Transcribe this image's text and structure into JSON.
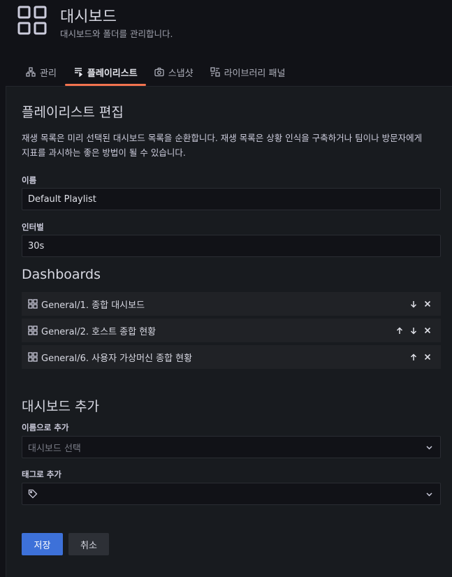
{
  "header": {
    "title": "대시보드",
    "subtitle": "대시보드와 폴더를 관리합니다."
  },
  "tabs": [
    {
      "label": "관리",
      "icon": "sitemap-icon",
      "active": false
    },
    {
      "label": "플레이리스트",
      "icon": "playlist-icon",
      "active": true
    },
    {
      "label": "스냅샷",
      "icon": "camera-icon",
      "active": false
    },
    {
      "label": "라이브러리 패널",
      "icon": "library-panel-icon",
      "active": false
    }
  ],
  "edit": {
    "heading": "플레이리스트 편집",
    "description": "재생 목록은 미리 선택된 대시보드 목록을 순환합니다. 재생 목록은 상황 인식을 구축하거나 팀이나 방문자에게 지표를 과시하는 좋은 방법이 될 수 있습니다.",
    "name_label": "이름",
    "name_value": "Default Playlist",
    "interval_label": "인터벌",
    "interval_value": "30s"
  },
  "dashboards": {
    "heading": "Dashboards",
    "items": [
      {
        "label": "General/1. 종합 대시보드"
      },
      {
        "label": "General/2. 호스트 종합 현황"
      },
      {
        "label": "General/6. 사용자 가상머신 종합 현황"
      }
    ]
  },
  "add": {
    "heading": "대시보드 추가",
    "by_name_label": "이름으로 추가",
    "by_name_placeholder": "대시보드 선택",
    "by_tag_label": "태그로 추가",
    "by_tag_value": ""
  },
  "buttons": {
    "save": "저장",
    "cancel": "취소"
  },
  "colors": {
    "accent_tab": "#f2734f",
    "primary_button": "#3d71d9",
    "background": "#111217",
    "panel": "#181b1f"
  }
}
